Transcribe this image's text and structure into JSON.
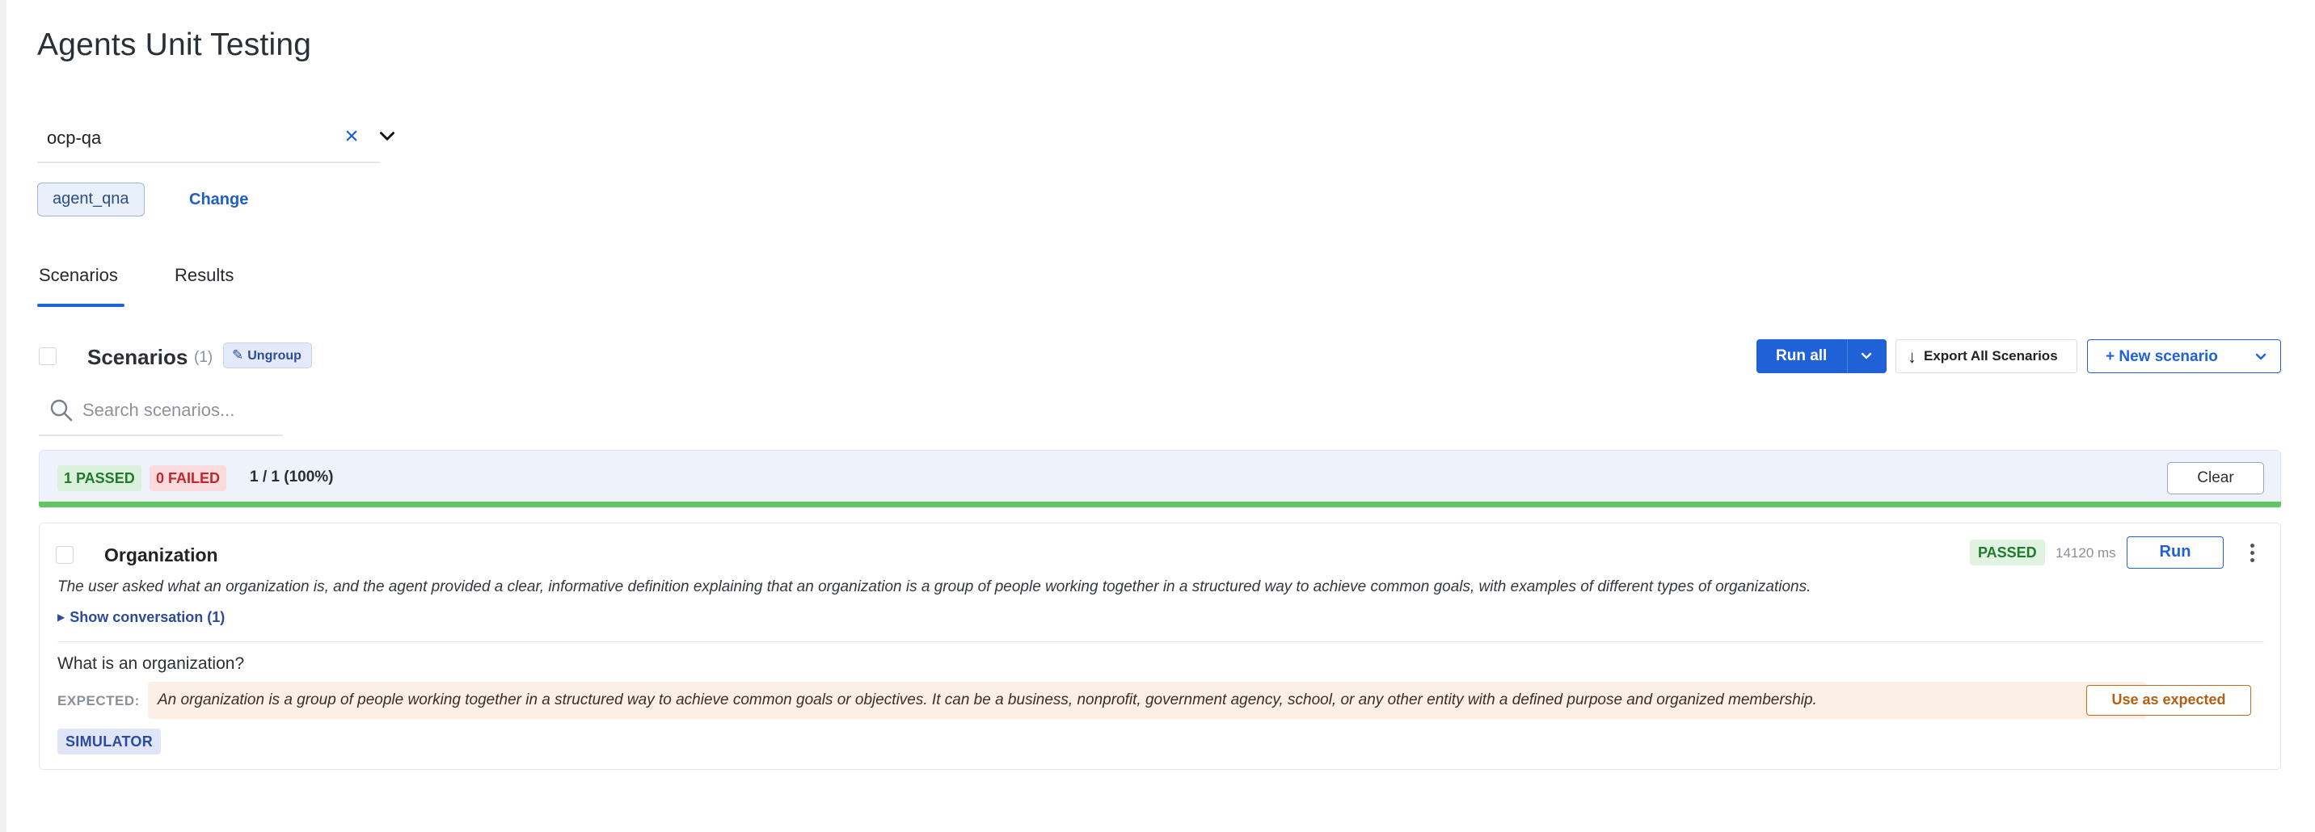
{
  "page": {
    "title": "Agents Unit Testing"
  },
  "project_select": {
    "value": "ocp-qa"
  },
  "agent": {
    "name": "agent_qna",
    "change_label": "Change"
  },
  "tabs": [
    {
      "label": "Scenarios",
      "active": true
    },
    {
      "label": "Results",
      "active": false
    }
  ],
  "scenarios": {
    "title": "Scenarios",
    "count": "(1)",
    "ungroup_label": "Ungroup",
    "run_all_label": "Run all",
    "export_label": "Export All Scenarios",
    "new_scenario_label": "+ New scenario",
    "search_placeholder": "Search scenarios..."
  },
  "summary": {
    "passed": "1 PASSED",
    "failed": "0 FAILED",
    "ratio": "1 / 1 (100%)",
    "pass_fraction": 1.0,
    "clear_label": "Clear"
  },
  "scenario_card": {
    "title": "Organization",
    "status": "PASSED",
    "duration": "14120 ms",
    "run_label": "Run",
    "summary": "The user asked what an organization is, and the agent provided a clear, informative definition explaining that an organization is a group of people working together in a structured way to achieve common goals, with examples of different types of organizations.",
    "show_conversation": "Show conversation (1)",
    "question": "What is an organization?",
    "expected_label": "EXPECTED:",
    "expected_text": "An organization is a group of people working together in a structured way to achieve common goals or objectives. It can be a business, nonprofit, government agency, school, or any other entity with a defined purpose and organized membership.",
    "use_as_expected_label": "Use as expected",
    "tag": "SIMULATOR"
  },
  "colors": {
    "accent": "#1f62d8",
    "pass": "#1f7a2e",
    "fail": "#c3262e",
    "progress": "#62c462"
  }
}
